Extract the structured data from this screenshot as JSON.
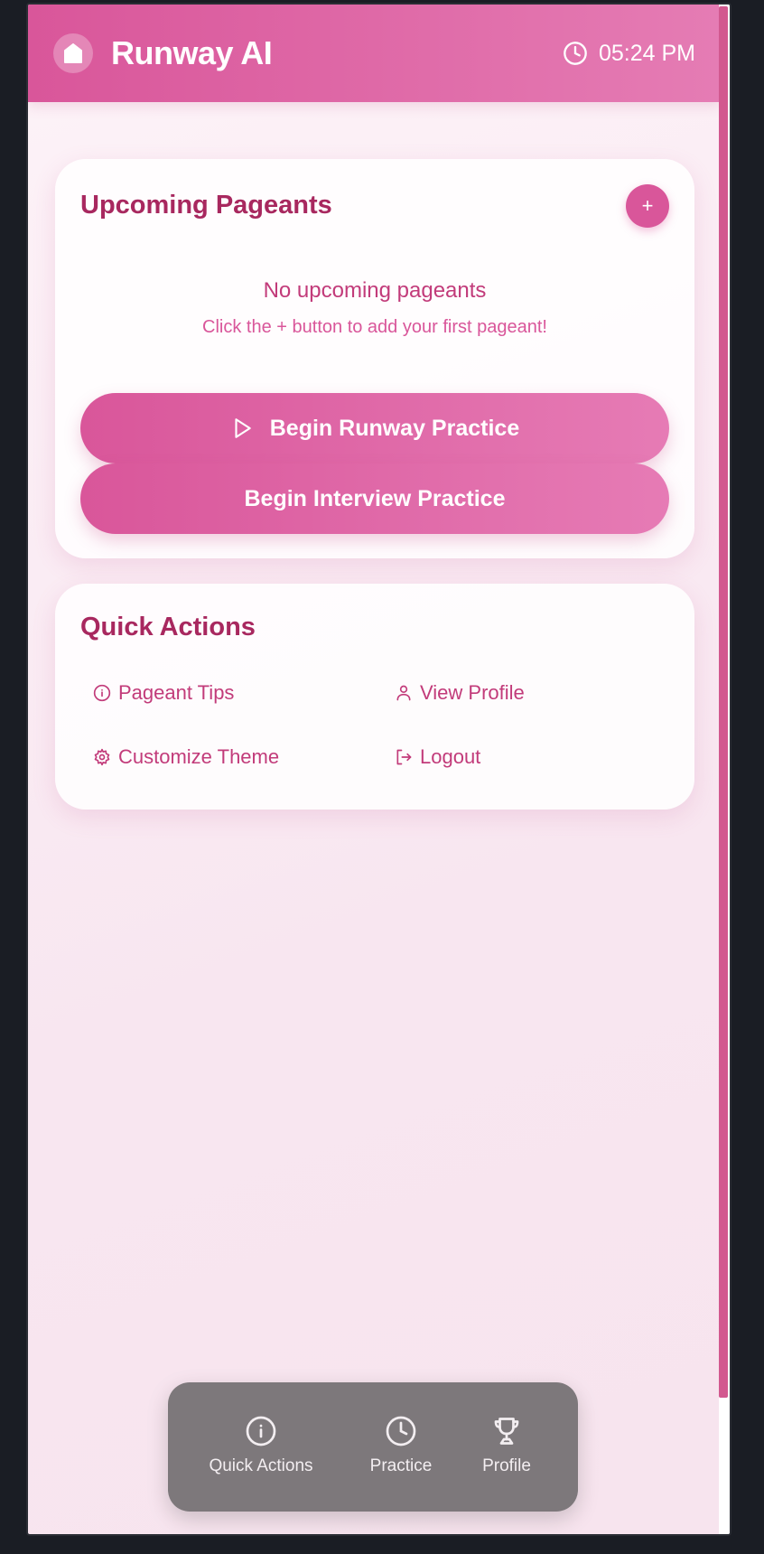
{
  "header": {
    "app_title": "Runway AI",
    "time": "05:24 PM",
    "accent_color": "#d9569a"
  },
  "upcoming": {
    "title": "Upcoming Pageants",
    "add_label": "+",
    "empty_title": "No upcoming pageants",
    "empty_subtitle": "Click the + button to add your first pageant!",
    "runway_button": "Begin Runway Practice",
    "interview_button": "Begin Interview Practice"
  },
  "quick_actions": {
    "title": "Quick Actions",
    "items": [
      {
        "label": "Pageant Tips",
        "icon": "info-icon"
      },
      {
        "label": "View Profile",
        "icon": "user-icon"
      },
      {
        "label": "Customize Theme",
        "icon": "gear-icon"
      },
      {
        "label": "Logout",
        "icon": "logout-icon"
      }
    ]
  },
  "bottom_nav": {
    "items": [
      {
        "label": "Quick Actions",
        "icon": "info-icon"
      },
      {
        "label": "Practice",
        "icon": "clock-icon"
      },
      {
        "label": "Profile",
        "icon": "trophy-icon"
      }
    ]
  }
}
